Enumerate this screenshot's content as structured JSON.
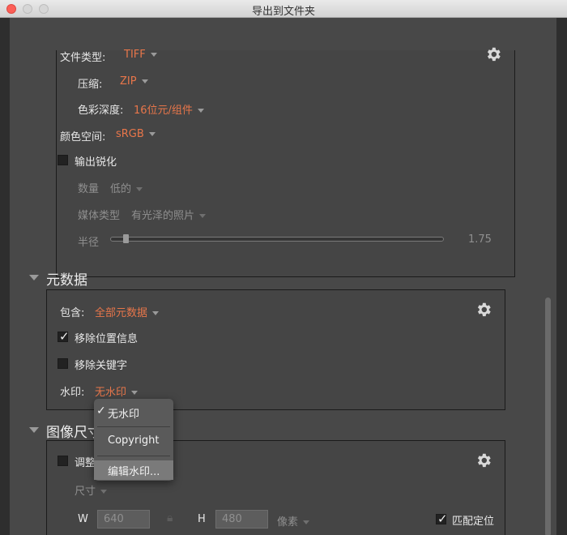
{
  "window": {
    "title": "导出到文件夹"
  },
  "file_settings": {
    "file_type_label": "文件类型:",
    "file_type_value": "TIFF",
    "compression_label": "压缩:",
    "compression_value": "ZIP",
    "bit_depth_label": "色彩深度:",
    "bit_depth_value": "16位元/组件",
    "color_space_label": "颜色空间:",
    "color_space_value": "sRGB",
    "sharpen_label": "输出锐化",
    "sharpen_checked": false,
    "amount_label": "数量",
    "amount_value": "低的",
    "media_label": "媒体类型",
    "media_value": "有光泽的照片",
    "radius_label": "半径",
    "radius_value": "1.75",
    "radius_level": 0.05
  },
  "metadata": {
    "title": "元数据",
    "include_label": "包含:",
    "include_value": "全部元数据",
    "remove_location_label": "移除位置信息",
    "remove_location_checked": true,
    "remove_keywords_label": "移除关键字",
    "remove_keywords_checked": false,
    "watermark_label": "水印:",
    "watermark_value": "无水印"
  },
  "watermark_menu": {
    "items": [
      {
        "label": "无水印",
        "checked": true
      },
      {
        "label": "Copyright",
        "checked": false
      },
      {
        "label": "编辑水印...",
        "checked": false
      }
    ]
  },
  "image_size": {
    "title": "图像尺寸",
    "resize_label": "调整",
    "resize_checked": false,
    "mode_value": "尺寸",
    "w_label": "W",
    "w_value": "640",
    "h_label": "H",
    "h_value": "480",
    "unit_value": "像素",
    "fit_label": "匹配定位",
    "fit_checked": true
  },
  "colors": {
    "accent": "#e8764a",
    "panel": "#454545",
    "background": "#484848"
  }
}
